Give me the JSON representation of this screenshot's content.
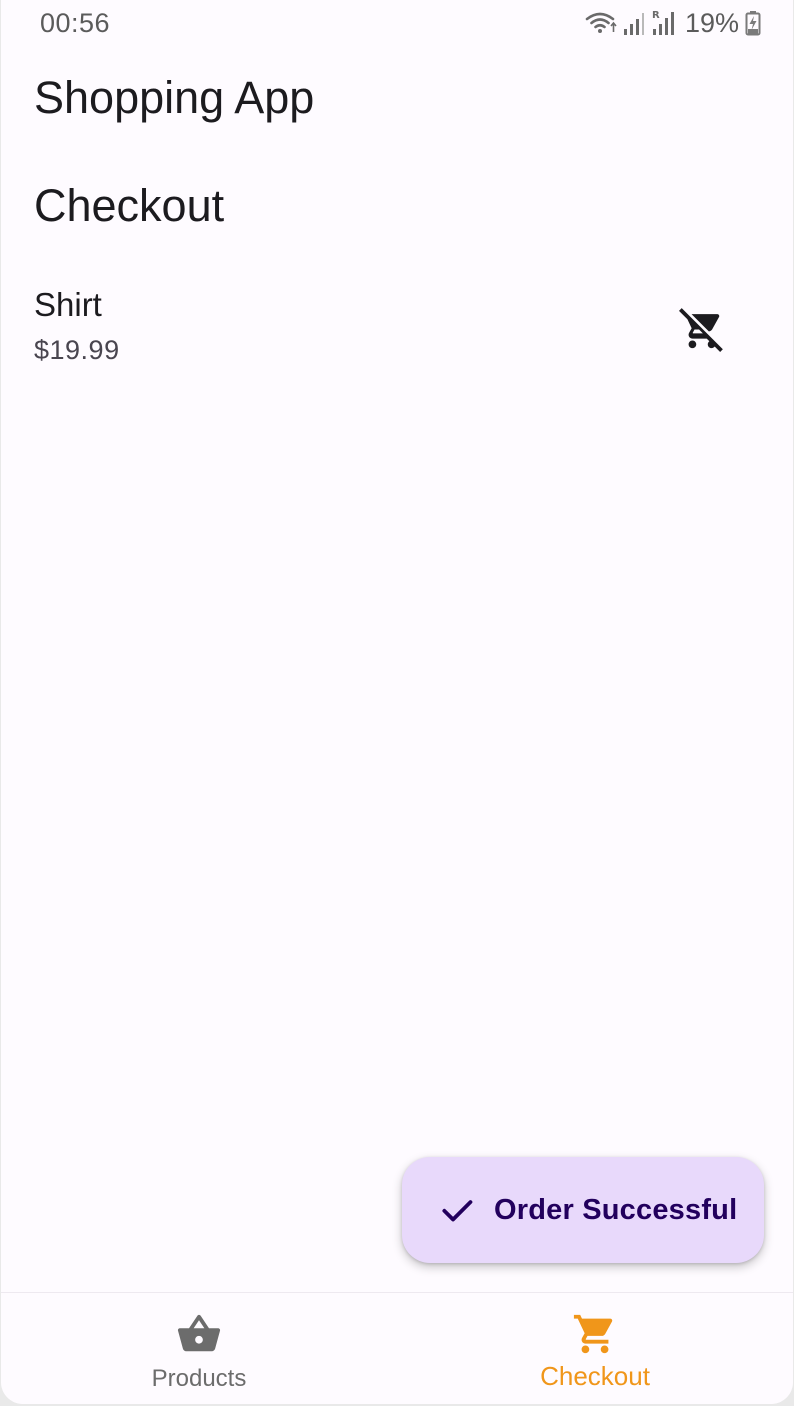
{
  "status_bar": {
    "time": "00:56",
    "battery_percent": "19%",
    "icons": [
      "wifi-icon",
      "signal-icon",
      "signal-roaming-icon",
      "battery-charging-icon"
    ]
  },
  "app": {
    "title": "Shopping App"
  },
  "page": {
    "heading": "Checkout"
  },
  "cart": {
    "items": [
      {
        "name": "Shirt",
        "price": "$19.99",
        "action_icon": "remove-shopping-cart-icon"
      }
    ]
  },
  "snackbar": {
    "icon": "check-icon",
    "label": "Order Successful"
  },
  "bottom_nav": {
    "items": [
      {
        "label": "Products",
        "icon": "shopping-basket-icon",
        "active": false
      },
      {
        "label": "Checkout",
        "icon": "shopping-cart-icon",
        "active": true
      }
    ]
  },
  "colors": {
    "background": "#fefbff",
    "text_primary": "#1c1b1f",
    "text_secondary": "#49454f",
    "nav_active": "#f0961a",
    "nav_inactive": "#6c6c6c",
    "snackbar_bg": "#e8d9fb",
    "snackbar_text": "#22005d"
  }
}
